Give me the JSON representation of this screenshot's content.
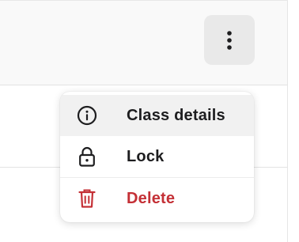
{
  "menu": {
    "items": [
      {
        "label": "Class details",
        "icon": "info-icon"
      },
      {
        "label": "Lock",
        "icon": "lock-icon"
      },
      {
        "label": "Delete",
        "icon": "trash-icon"
      }
    ]
  },
  "colors": {
    "danger": "#c43036",
    "text": "#1d1d1f",
    "button_bg": "#e9e9e9"
  }
}
